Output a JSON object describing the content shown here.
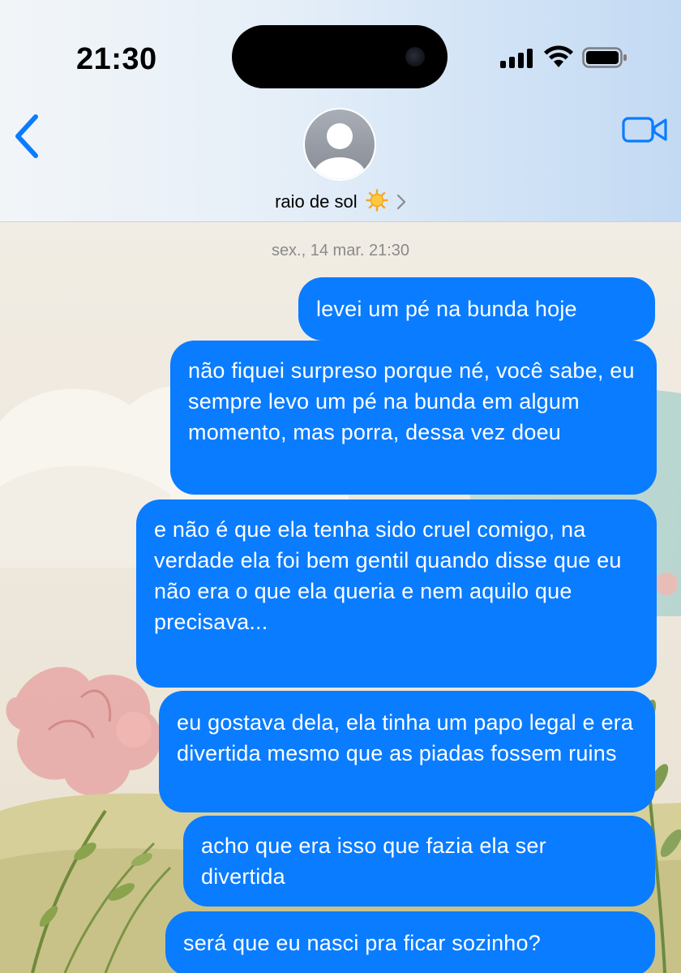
{
  "status_bar": {
    "time": "21:30"
  },
  "header": {
    "back_icon": "chevron-left-icon",
    "video_icon": "video-camera-icon",
    "avatar_icon": "person-silhouette-icon",
    "contact_name": "raio de sol",
    "contact_emoji": "sun-emoji",
    "chevron": "›"
  },
  "conversation": {
    "timestamp": "sex., 14 mar. 21:30",
    "messages": [
      {
        "text": "levei um pé na bunda hoje",
        "sender": "me"
      },
      {
        "text": "não fiquei surpreso porque né, você sabe, eu sempre levo um pé na bunda em algum momento, mas porra, dessa vez doeu",
        "sender": "me"
      },
      {
        "text": "e não é que ela tenha sido cruel comigo, na verdade ela foi bem gentil quando disse que eu não era o que ela queria e nem aquilo que precisava...",
        "sender": "me"
      },
      {
        "text": "eu gostava dela, ela tinha um papo legal e era divertida mesmo que as piadas fossem ruins",
        "sender": "me"
      },
      {
        "text": "acho que era isso que fazia ela ser divertida",
        "sender": "me"
      },
      {
        "text": "será que eu nasci pra ficar sozinho?",
        "sender": "me"
      }
    ]
  },
  "colors": {
    "bubble": "#0a7cff",
    "accent": "#0a7cff",
    "timestamp_text": "#8a8a8a"
  }
}
